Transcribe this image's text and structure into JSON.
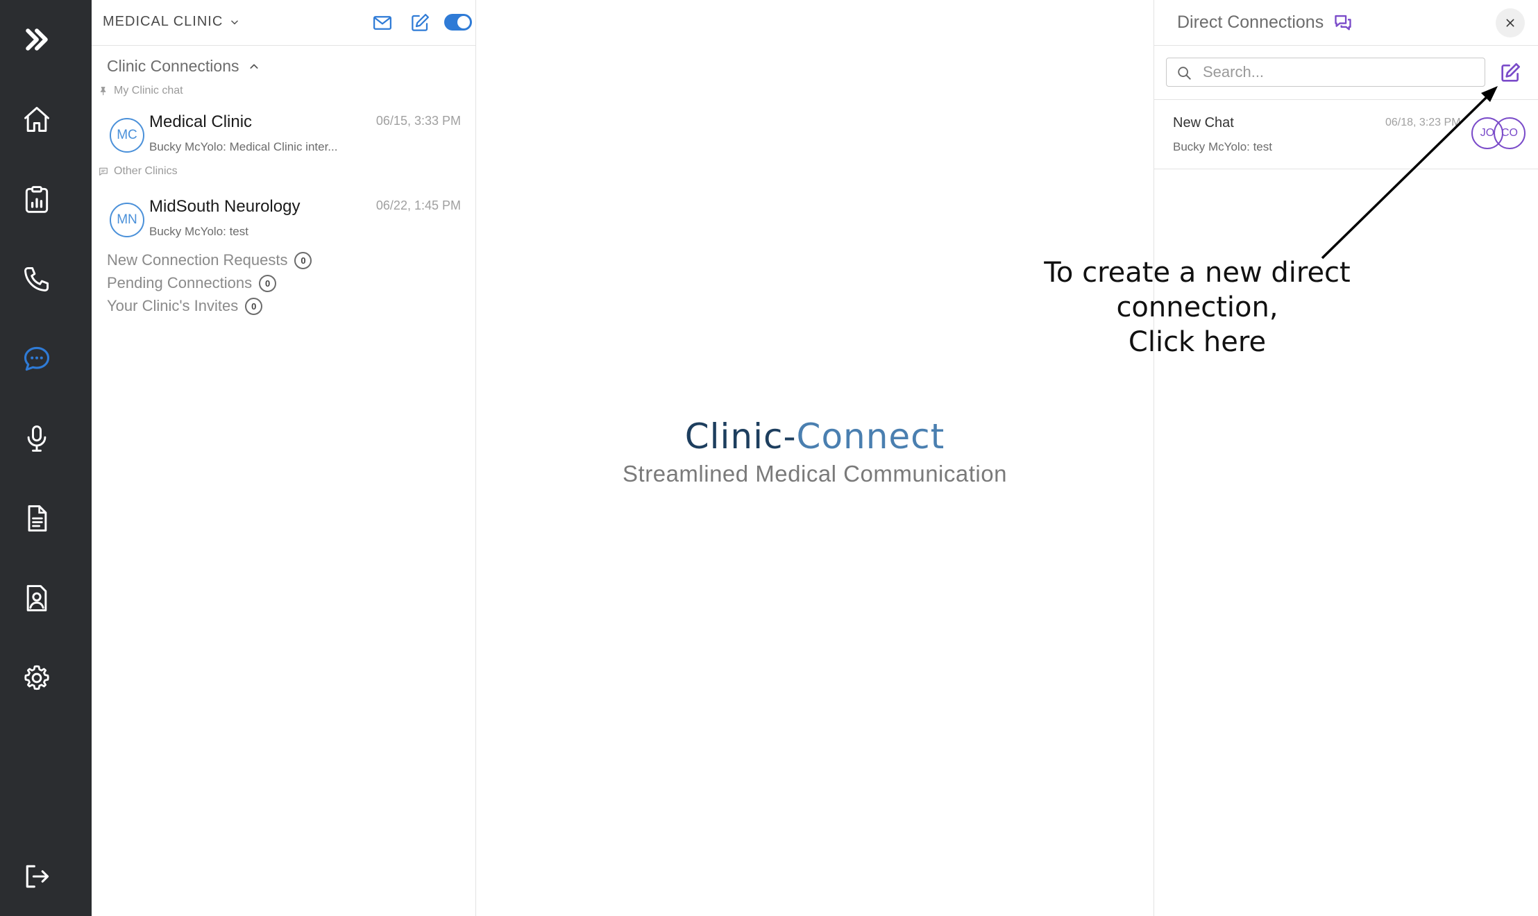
{
  "rail": {
    "items": [
      {
        "name": "expand",
        "icon": "double-chevron-right-icon"
      },
      {
        "name": "home",
        "icon": "home-icon"
      },
      {
        "name": "reports",
        "icon": "clipboard-chart-icon"
      },
      {
        "name": "calls",
        "icon": "phone-icon"
      },
      {
        "name": "messages",
        "icon": "chat-bubble-icon",
        "active": true
      },
      {
        "name": "dictation",
        "icon": "microphone-icon"
      },
      {
        "name": "documents",
        "icon": "document-icon"
      },
      {
        "name": "patients",
        "icon": "patient-file-icon"
      },
      {
        "name": "settings",
        "icon": "gear-icon"
      },
      {
        "name": "logout",
        "icon": "logout-icon"
      }
    ],
    "active_color": "#2f7bd6"
  },
  "list_panel": {
    "org_name": "MEDICAL CLINIC",
    "toggle_on": true,
    "section_title": "Clinic Connections",
    "my_group_label": "My Clinic chat",
    "other_group_label": "Other Clinics",
    "conversations": [
      {
        "initials": "MC",
        "name": "Medical Clinic",
        "time": "06/15, 3:33 PM",
        "preview": "Bucky McYolo: Medical Clinic inter..."
      },
      {
        "initials": "MN",
        "name": "MidSouth Neurology",
        "time": "06/22, 1:45 PM",
        "preview": "Bucky McYolo: test"
      }
    ],
    "requests": [
      {
        "label": "New Connection Requests",
        "count": "0"
      },
      {
        "label": "Pending Connections",
        "count": "0"
      },
      {
        "label": "Your Clinic's Invites",
        "count": "0"
      }
    ]
  },
  "brand": {
    "name": "Clinic-Connect",
    "tagline": "Streamlined Medical Communication"
  },
  "direct_panel": {
    "title": "Direct Connections",
    "search_placeholder": "Search...",
    "accent_color": "#7a4bc9",
    "chats": [
      {
        "name": "New Chat",
        "time": "06/18, 3:23 PM",
        "preview": "Bucky McYolo: test",
        "participants": [
          "JO",
          "CO"
        ]
      }
    ]
  },
  "annotation": {
    "line1": "To create a new direct connection,",
    "line2": "Click here"
  }
}
